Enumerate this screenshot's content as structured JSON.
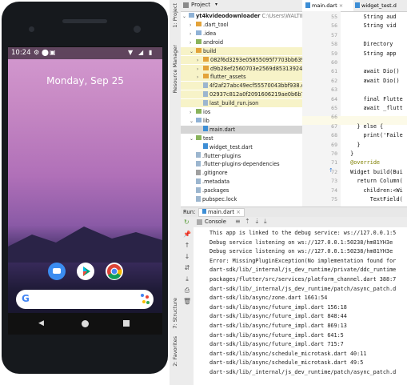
{
  "phone": {
    "time": "10:24",
    "date": "Monday, Sep 25",
    "dock": [
      "messages-icon",
      "play-store-icon",
      "chrome-icon"
    ]
  },
  "ide": {
    "project_label": "Project",
    "side_tabs": {
      "project": "1: Project",
      "resource": "Resource Manager",
      "structure": "7: Structure",
      "favorites": "2: Favorites"
    },
    "project_root": "yt4kvideodownloader",
    "project_root_path": "C:\\Users\\WALTIBAS0\\And",
    "tree": [
      {
        "indent": 1,
        "type": "folder-o",
        "caret": "›",
        "label": ".dart_tool"
      },
      {
        "indent": 1,
        "type": "folder-b",
        "caret": "›",
        "label": ".idea"
      },
      {
        "indent": 1,
        "type": "folder-g",
        "caret": "›",
        "label": "android"
      },
      {
        "indent": 1,
        "type": "folder-o",
        "caret": "⌄",
        "label": "build",
        "cls": "yellow"
      },
      {
        "indent": 2,
        "type": "folder-o",
        "caret": "›",
        "label": "082f6d3293e05855095f7703bb6393cf",
        "cls": "yellow"
      },
      {
        "indent": 2,
        "type": "folder-o",
        "caret": "›",
        "label": "d9b28ef2560703e2569d853139242621b",
        "cls": "yellow"
      },
      {
        "indent": 2,
        "type": "folder-o",
        "caret": "›",
        "label": "flutter_assets",
        "cls": "yellow"
      },
      {
        "indent": 2,
        "type": "file",
        "caret": "",
        "label": "4f2af27abc49ecf55570043bbf938.cach",
        "cls": "yellow"
      },
      {
        "indent": 2,
        "type": "file",
        "caret": "",
        "label": "02937c812a0f2091606219ae0b6b7efc.cach",
        "cls": "yellow"
      },
      {
        "indent": 2,
        "type": "file",
        "caret": "",
        "label": "last_build_run.json",
        "cls": "yellow"
      },
      {
        "indent": 1,
        "type": "folder-g",
        "caret": "›",
        "label": "ios"
      },
      {
        "indent": 1,
        "type": "folder-b",
        "caret": "⌄",
        "label": "lib"
      },
      {
        "indent": 2,
        "type": "file-dart",
        "caret": "",
        "label": "main.dart",
        "cls": "sel"
      },
      {
        "indent": 1,
        "type": "folder-g",
        "caret": "⌄",
        "label": "test"
      },
      {
        "indent": 2,
        "type": "file-dart",
        "caret": "",
        "label": "widget_test.dart"
      },
      {
        "indent": 1,
        "type": "file",
        "caret": "",
        "label": ".flutter-plugins"
      },
      {
        "indent": 1,
        "type": "file",
        "caret": "",
        "label": ".flutter-plugins-dependencies"
      },
      {
        "indent": 1,
        "type": "file-git",
        "caret": "",
        "label": ".gitignore"
      },
      {
        "indent": 1,
        "type": "file",
        "caret": "",
        "label": ".metadata"
      },
      {
        "indent": 1,
        "type": "file",
        "caret": "",
        "label": ".packages"
      },
      {
        "indent": 1,
        "type": "file",
        "caret": "",
        "label": "pubspec.lock"
      }
    ],
    "tabs": [
      "main.dart",
      "widget_test.d"
    ],
    "line_numbers": [
      "55",
      "56",
      "57",
      "58",
      "59",
      "60",
      "61",
      "62",
      "63",
      "64",
      "65",
      "66",
      "67",
      "68",
      "69",
      "70",
      "71",
      "72",
      "73",
      "74",
      "75"
    ],
    "code_lines": [
      "      String aud",
      "      String vid",
      "",
      "      Directory",
      "      String app",
      "",
      "      await Dio()",
      "      await Dio()",
      "",
      "      final Flutte",
      "      await _flutt",
      "",
      "    } else {",
      "      print('Faile",
      "    }",
      "  }",
      "  @override",
      "  Widget build(Bui",
      "    return Column(",
      "      children:<Wi",
      "        TextField("
    ],
    "run_label": "Run:",
    "run_tab": "main.dart",
    "console_label": "Console",
    "console_lines": [
      "This app is linked to the debug service: ws://127.0.0.1:5",
      "Debug service listening on ws://127.0.0.1:50238/hm81YH3e",
      "Debug service listening on ws://127.0.0.1:50238/hm81YH3e",
      "Error: MissingPluginException(No implementation found for",
      "dart-sdk/lib/_internal/js_dev_runtime/private/ddc_runtime",
      "packages/flutter/src/services/platform_channel.dart 388:7",
      "dart-sdk/lib/_internal/js_dev_runtime/patch/async_patch.d",
      "dart-sdk/lib/async/zone.dart 1661:54",
      "dart-sdk/lib/async/future_impl.dart 156:18",
      "dart-sdk/lib/async/future_impl.dart 848:44",
      "dart-sdk/lib/async/future_impl.dart 869:13",
      "dart-sdk/lib/async/future_impl.dart 641:5",
      "dart-sdk/lib/async/future_impl.dart 715:7",
      "dart-sdk/lib/async/schedule_microtask.dart 40:11",
      "dart-sdk/lib/async/schedule_microtask.dart 49:5",
      "dart-sdk/lib/_internal/js_dev_runtime/patch/async_patch.d"
    ]
  }
}
